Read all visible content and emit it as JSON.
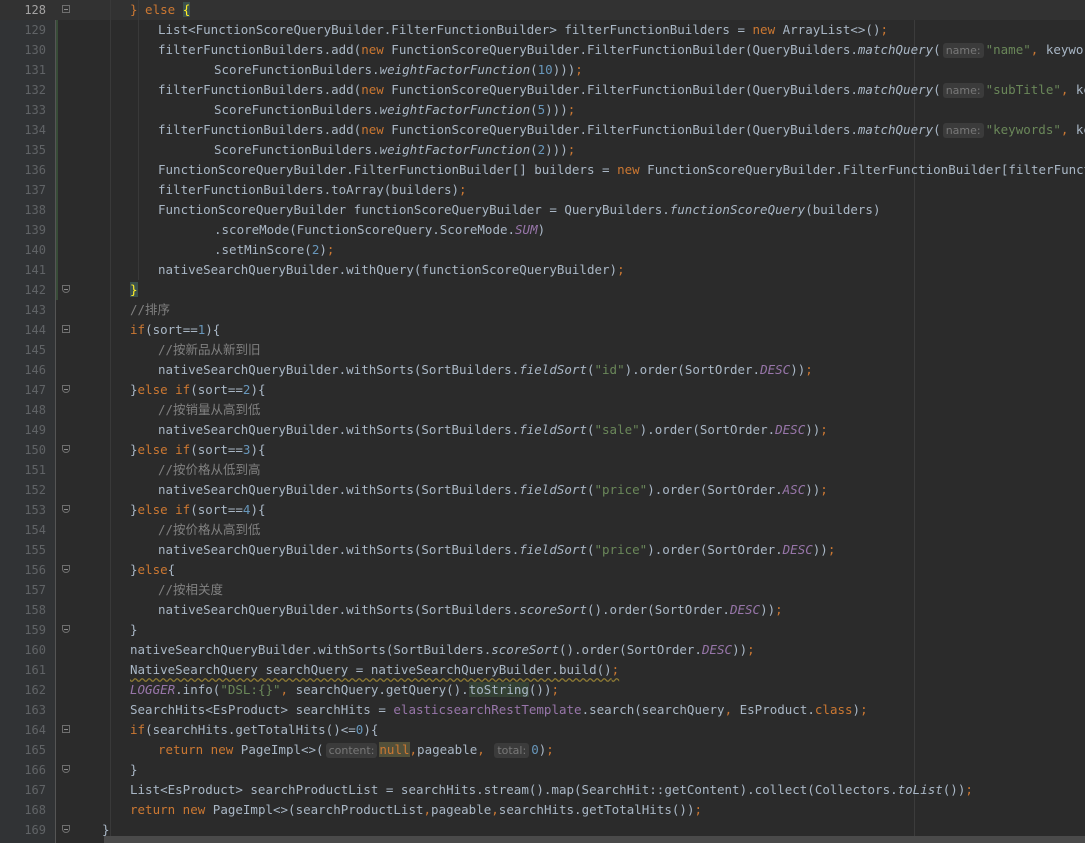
{
  "editor": {
    "lines": [
      {
        "n": "128",
        "indent": 2,
        "fold": "open",
        "html": "<span class=\"kw\">} else </span><span class=\"brace-hl\">{</span>"
      },
      {
        "n": "129",
        "indent": 3,
        "html": "List&lt;FunctionScoreQueryBuilder.FilterFunctionBuilder&gt; filterFunctionBuilders = <span class=\"kw\">new</span> ArrayList&lt;&gt;()<span class=\"kw\">;</span>"
      },
      {
        "n": "130",
        "indent": 3,
        "html": "filterFunctionBuilders.add(<span class=\"kw\">new</span> FunctionScoreQueryBuilder.FilterFunctionBuilder(QueryBuilders.<span class=\"it\">matchQuery</span>(<span class=\"hint\">name:</span><span class=\"str\">\"name\"</span><span class=\"kw\">,</span> keyword)<span class=\"kw\">,</span>"
      },
      {
        "n": "131",
        "indent": 5,
        "html": "ScoreFunctionBuilders.<span class=\"it\">weightFactorFunction</span>(<span class=\"num\">10</span>)))<span class=\"kw\">;</span>"
      },
      {
        "n": "132",
        "indent": 3,
        "html": "filterFunctionBuilders.add(<span class=\"kw\">new</span> FunctionScoreQueryBuilder.FilterFunctionBuilder(QueryBuilders.<span class=\"it\">matchQuery</span>(<span class=\"hint\">name:</span><span class=\"str\">\"subTitle\"</span><span class=\"kw\">,</span> keyword)<span class=\"kw\">,</span>"
      },
      {
        "n": "133",
        "indent": 5,
        "html": "ScoreFunctionBuilders.<span class=\"it\">weightFactorFunction</span>(<span class=\"num\">5</span>)))<span class=\"kw\">;</span>"
      },
      {
        "n": "134",
        "indent": 3,
        "html": "filterFunctionBuilders.add(<span class=\"kw\">new</span> FunctionScoreQueryBuilder.FilterFunctionBuilder(QueryBuilders.<span class=\"it\">matchQuery</span>(<span class=\"hint\">name:</span><span class=\"str\">\"keywords\"</span><span class=\"kw\">,</span> keyword)<span class=\"kw\">,</span>"
      },
      {
        "n": "135",
        "indent": 5,
        "html": "ScoreFunctionBuilders.<span class=\"it\">weightFactorFunction</span>(<span class=\"num\">2</span>)))<span class=\"kw\">;</span>"
      },
      {
        "n": "136",
        "indent": 3,
        "html": "FunctionScoreQueryBuilder.FilterFunctionBuilder[] builders = <span class=\"kw\">new</span> FunctionScoreQueryBuilder.FilterFunctionBuilder[filterFunctionBuilders.size()]<span class=\"kw\">;</span>"
      },
      {
        "n": "137",
        "indent": 3,
        "html": "filterFunctionBuilders.toArray(builders)<span class=\"kw\">;</span>"
      },
      {
        "n": "138",
        "indent": 3,
        "html": "FunctionScoreQueryBuilder functionScoreQueryBuilder = QueryBuilders.<span class=\"it\">functionScoreQuery</span>(builders)"
      },
      {
        "n": "139",
        "indent": 5,
        "html": ".scoreMode(FunctionScoreQuery.ScoreMode.<span class=\"cst\">SUM</span>)"
      },
      {
        "n": "140",
        "indent": 5,
        "html": ".setMinScore(<span class=\"num\">2</span>)<span class=\"kw\">;</span>"
      },
      {
        "n": "141",
        "indent": 3,
        "html": "nativeSearchQueryBuilder.withQuery(functionScoreQueryBuilder)<span class=\"kw\">;</span>"
      },
      {
        "n": "142",
        "indent": 2,
        "fold": "close",
        "html": "<span class=\"brace-hl\">}</span>"
      },
      {
        "n": "143",
        "indent": 2,
        "html": "<span class=\"cmt\">//排序</span>"
      },
      {
        "n": "144",
        "indent": 2,
        "fold": "open",
        "html": "<span class=\"kw\">if</span>(sort==<span class=\"num\">1</span>){"
      },
      {
        "n": "145",
        "indent": 3,
        "html": "<span class=\"cmt\">//按新品从新到旧</span>"
      },
      {
        "n": "146",
        "indent": 3,
        "html": "nativeSearchQueryBuilder.withSorts(SortBuilders.<span class=\"it\">fieldSort</span>(<span class=\"str\">\"id\"</span>).order(SortOrder.<span class=\"cst\">DESC</span>))<span class=\"kw\">;</span>"
      },
      {
        "n": "147",
        "indent": 2,
        "fold": "close",
        "html": "}<span class=\"kw\">else if</span>(sort==<span class=\"num\">2</span>){"
      },
      {
        "n": "148",
        "indent": 3,
        "html": "<span class=\"cmt\">//按销量从高到低</span>"
      },
      {
        "n": "149",
        "indent": 3,
        "html": "nativeSearchQueryBuilder.withSorts(SortBuilders.<span class=\"it\">fieldSort</span>(<span class=\"str\">\"sale\"</span>).order(SortOrder.<span class=\"cst\">DESC</span>))<span class=\"kw\">;</span>"
      },
      {
        "n": "150",
        "indent": 2,
        "fold": "close",
        "html": "}<span class=\"kw\">else if</span>(sort==<span class=\"num\">3</span>){"
      },
      {
        "n": "151",
        "indent": 3,
        "html": "<span class=\"cmt\">//按价格从低到高</span>"
      },
      {
        "n": "152",
        "indent": 3,
        "html": "nativeSearchQueryBuilder.withSorts(SortBuilders.<span class=\"it\">fieldSort</span>(<span class=\"str\">\"price\"</span>).order(SortOrder.<span class=\"cst\">ASC</span>))<span class=\"kw\">;</span>"
      },
      {
        "n": "153",
        "indent": 2,
        "fold": "close",
        "html": "}<span class=\"kw\">else if</span>(sort==<span class=\"num\">4</span>){"
      },
      {
        "n": "154",
        "indent": 3,
        "html": "<span class=\"cmt\">//按价格从高到低</span>"
      },
      {
        "n": "155",
        "indent": 3,
        "html": "nativeSearchQueryBuilder.withSorts(SortBuilders.<span class=\"it\">fieldSort</span>(<span class=\"str\">\"price\"</span>).order(SortOrder.<span class=\"cst\">DESC</span>))<span class=\"kw\">;</span>"
      },
      {
        "n": "156",
        "indent": 2,
        "fold": "close",
        "html": "}<span class=\"kw\">else</span>{"
      },
      {
        "n": "157",
        "indent": 3,
        "html": "<span class=\"cmt\">//按相关度</span>"
      },
      {
        "n": "158",
        "indent": 3,
        "html": "nativeSearchQueryBuilder.withSorts(SortBuilders.<span class=\"it\">scoreSort</span>().order(SortOrder.<span class=\"cst\">DESC</span>))<span class=\"kw\">;</span>"
      },
      {
        "n": "159",
        "indent": 2,
        "fold": "close",
        "html": "}"
      },
      {
        "n": "160",
        "indent": 2,
        "html": "nativeSearchQueryBuilder.withSorts(SortBuilders.<span class=\"it\">scoreSort</span>().order(SortOrder.<span class=\"cst\">DESC</span>))<span class=\"kw\">;</span>"
      },
      {
        "n": "161",
        "indent": 2,
        "html": "<span class=\"warn\">NativeSearchQuery searchQuery = nativeSearchQueryBuilder.build()<span class=\"kw\">;</span></span>"
      },
      {
        "n": "162",
        "indent": 2,
        "html": "<span class=\"cst\">LOGGER</span>.info(<span class=\"str\">\"DSL:{}\"</span><span class=\"kw\">,</span> searchQuery.getQuery().<span class=\"hl\">toString</span>())<span class=\"kw\">;</span>"
      },
      {
        "n": "163",
        "indent": 2,
        "html": "SearchHits&lt;EsProduct&gt; searchHits = <span class=\"field\">elasticsearchRestTemplate</span>.search(searchQuery<span class=\"kw\">,</span> EsProduct.<span class=\"kw\">class</span>)<span class=\"kw\">;</span>"
      },
      {
        "n": "164",
        "indent": 2,
        "fold": "open",
        "html": "<span class=\"kw\">if</span>(searchHits.getTotalHits()&lt;=<span class=\"num\">0</span>){"
      },
      {
        "n": "165",
        "indent": 3,
        "html": "<span class=\"kw\">return new</span> PageImpl&lt;&gt;(<span class=\"hint\">content:</span><span class=\"nullhl\">null</span><span class=\"kw\">,</span>pageable<span class=\"kw\">,</span> <span class=\"hint\">total:</span><span class=\"num\">0</span>)<span class=\"kw\">;</span>"
      },
      {
        "n": "166",
        "indent": 2,
        "fold": "close",
        "html": "}"
      },
      {
        "n": "167",
        "indent": 2,
        "html": "List&lt;EsProduct&gt; searchProductList = searchHits.stream().map(SearchHit::getContent).collect(Collectors.<span class=\"it\">toList</span>())<span class=\"kw\">;</span>"
      },
      {
        "n": "168",
        "indent": 2,
        "html": "<span class=\"kw\">return new</span> PageImpl&lt;&gt;(searchProductList<span class=\"kw\">,</span>pageable<span class=\"kw\">,</span>searchHits.getTotalHits())<span class=\"kw\">;</span>"
      },
      {
        "n": "169",
        "indent": 1,
        "fold": "close",
        "html": "}"
      }
    ]
  }
}
